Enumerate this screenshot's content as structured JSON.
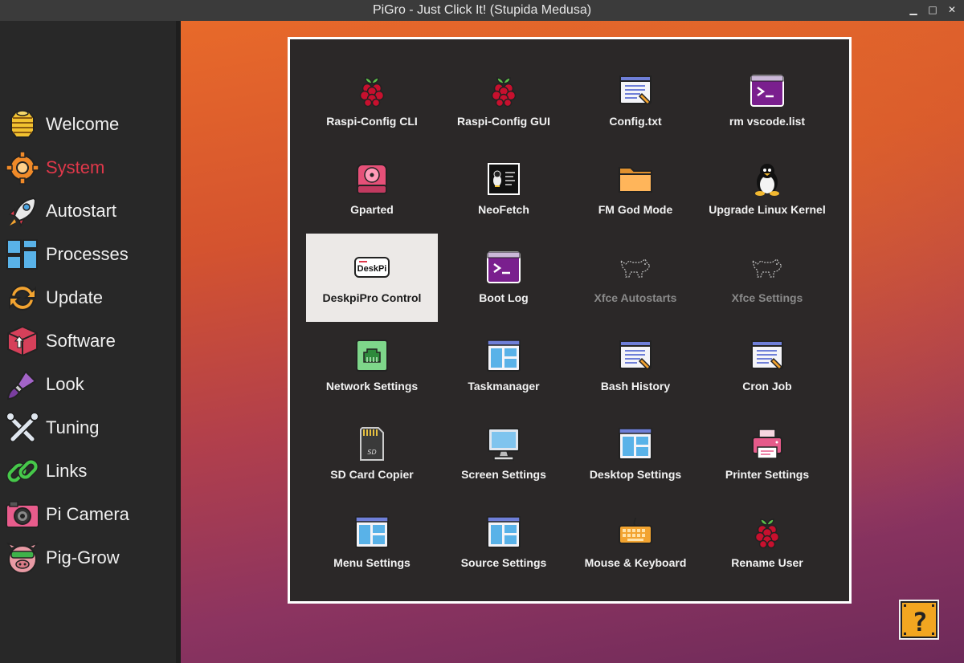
{
  "window": {
    "title": "PiGro - Just Click It! (Stupida Medusa)",
    "minimize": "▁",
    "maximize": "□",
    "close": "✕"
  },
  "sidebar": {
    "active": "System",
    "items": [
      {
        "label": "Welcome",
        "icon": "bee-hive-icon"
      },
      {
        "label": "System",
        "icon": "gear-icon"
      },
      {
        "label": "Autostart",
        "icon": "rocket-icon"
      },
      {
        "label": "Processes",
        "icon": "window-tiles-icon"
      },
      {
        "label": "Update",
        "icon": "refresh-arrows-icon"
      },
      {
        "label": "Software",
        "icon": "package-box-icon"
      },
      {
        "label": "Look",
        "icon": "paint-brush-icon"
      },
      {
        "label": "Tuning",
        "icon": "wrenches-icon"
      },
      {
        "label": "Links",
        "icon": "chain-link-icon"
      },
      {
        "label": "Pi Camera",
        "icon": "camera-icon"
      },
      {
        "label": "Pig-Grow",
        "icon": "pig-face-icon"
      }
    ]
  },
  "tiles": [
    {
      "label": "Raspi-Config CLI",
      "icon": "raspberry-icon"
    },
    {
      "label": "Raspi-Config GUI",
      "icon": "raspberry-icon"
    },
    {
      "label": "Config.txt",
      "icon": "text-editor-icon"
    },
    {
      "label": "rm vscode.list",
      "icon": "terminal-icon"
    },
    {
      "label": "Gparted",
      "icon": "disk-drive-icon"
    },
    {
      "label": "NeoFetch",
      "icon": "neofetch-terminal-icon"
    },
    {
      "label": "FM God Mode",
      "icon": "folder-icon"
    },
    {
      "label": "Upgrade Linux Kernel",
      "icon": "tux-penguin-icon"
    },
    {
      "label": "DeskpiPro Control",
      "icon": "deskpi-logo-icon",
      "logo_text": "DeskPi",
      "selected": true
    },
    {
      "label": "Boot Log",
      "icon": "terminal-icon"
    },
    {
      "label": "Xfce Autostarts",
      "icon": "xfce-mouse-icon",
      "disabled": true
    },
    {
      "label": "Xfce Settings",
      "icon": "xfce-mouse-icon",
      "disabled": true
    },
    {
      "label": "Network Settings",
      "icon": "network-port-icon"
    },
    {
      "label": "Taskmanager",
      "icon": "window-layout-icon"
    },
    {
      "label": "Bash History",
      "icon": "text-editor-icon"
    },
    {
      "label": "Cron Job",
      "icon": "text-editor-icon"
    },
    {
      "label": "SD Card Copier",
      "icon": "sd-card-icon"
    },
    {
      "label": "Screen Settings",
      "icon": "monitor-icon"
    },
    {
      "label": "Desktop Settings",
      "icon": "window-layout-icon"
    },
    {
      "label": "Printer Settings",
      "icon": "printer-icon"
    },
    {
      "label": "Menu Settings",
      "icon": "window-layout-icon"
    },
    {
      "label": "Source Settings",
      "icon": "window-layout-icon"
    },
    {
      "label": "Mouse & Keyboard",
      "icon": "keyboard-icon"
    },
    {
      "label": "Rename User",
      "icon": "raspberry-icon"
    }
  ],
  "help": {
    "icon": "question-block-icon",
    "glyph": "?"
  },
  "colors": {
    "active_item": "#e0384a",
    "panel_bg": "#2b2828",
    "sidebar_bg": "#282828",
    "selected_tile_bg": "#ece9e7"
  }
}
